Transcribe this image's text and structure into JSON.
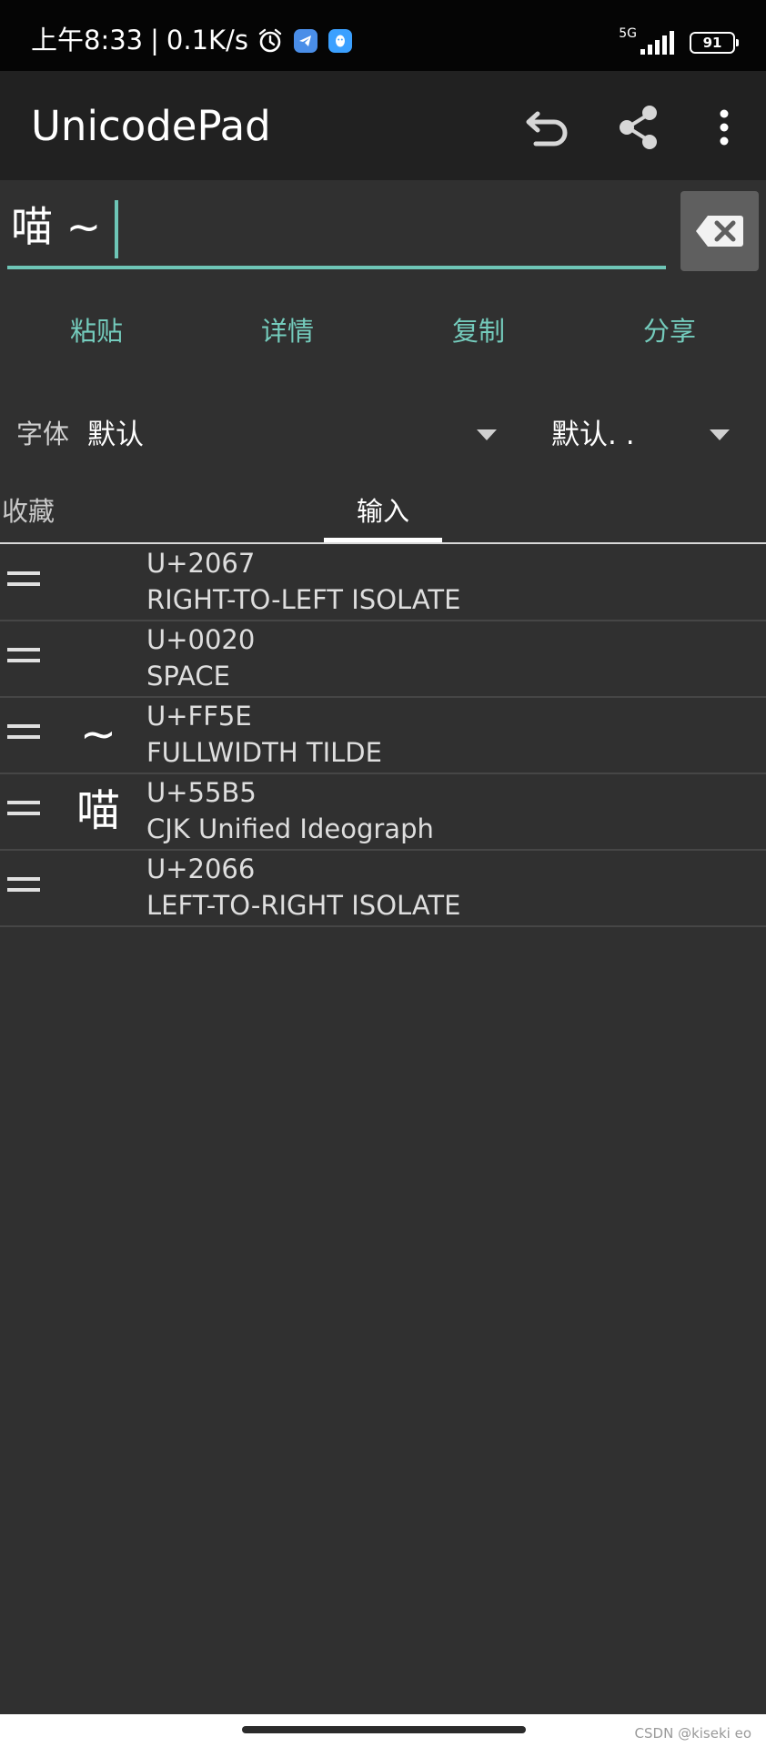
{
  "status_bar": {
    "time": "上午8:33",
    "separator": "|",
    "net_speed": "0.1K/s",
    "network": "5G",
    "battery": "91"
  },
  "app_bar": {
    "title": "UnicodePad",
    "icons": [
      "undo-icon",
      "share-icon",
      "more-vert-icon"
    ]
  },
  "input": {
    "value": "喵 ~ "
  },
  "actions": {
    "paste": "粘贴",
    "details": "详情",
    "copy": "复制",
    "share": "分享"
  },
  "font": {
    "label": "字体",
    "value": "默认",
    "value2": "默认. ."
  },
  "tabs": {
    "favorites": "收藏",
    "input": "输入",
    "active": "input"
  },
  "characters": [
    {
      "glyph": "",
      "code": "U+2067",
      "name": "RIGHT-TO-LEFT ISOLATE"
    },
    {
      "glyph": "",
      "code": "U+0020",
      "name": "SPACE"
    },
    {
      "glyph": "~",
      "code": "U+FF5E",
      "name": "FULLWIDTH TILDE"
    },
    {
      "glyph": "喵",
      "code": "U+55B5",
      "name": "CJK Unified Ideograph"
    },
    {
      "glyph": "",
      "code": "U+2066",
      "name": "LEFT-TO-RIGHT ISOLATE"
    }
  ],
  "watermark": "CSDN @kiseki eo",
  "colors": {
    "accent": "#74cbbc",
    "background": "#303030",
    "app_bar": "#212121"
  }
}
